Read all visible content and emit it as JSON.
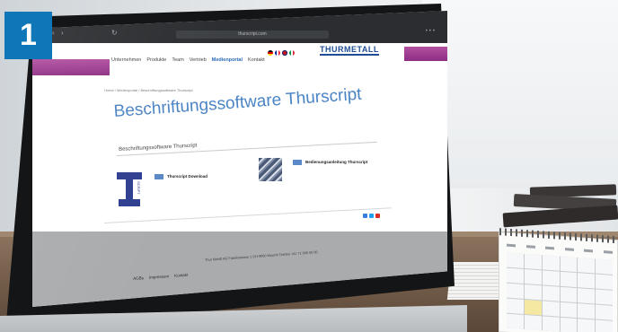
{
  "step_badge": "1",
  "browser": {
    "url": "thurscript.com"
  },
  "site": {
    "logo_text": "THURMETALL",
    "nav": [
      {
        "label": "Unternehmen",
        "active": false
      },
      {
        "label": "Produkte",
        "active": false
      },
      {
        "label": "Team",
        "active": false
      },
      {
        "label": "Vertrieb",
        "active": false
      },
      {
        "label": "Medienportal",
        "active": true
      },
      {
        "label": "Kontakt",
        "active": false
      }
    ],
    "breadcrumb": "Home  /  Medienportal  /  Beschriftungssoftware Thurscript",
    "page_title": "Beschriftungssoftware Thurscript",
    "section_heading": "Beschriftungssoftware Thurscript",
    "cards": [
      {
        "label": "Thurscript Download",
        "logo_caption": "SCRIPT"
      },
      {
        "label": "Bedienungsanleitung Thurscript"
      }
    ],
    "footer": {
      "address": "Thur Metall AG   Fabrikstrasse 1   CH-9000 Wuerth   Telefon +41 71 000 00 00",
      "links": [
        "AGBs",
        "Impressum",
        "Kontakt"
      ]
    }
  },
  "colors": {
    "badge": "#0f77b8",
    "accent_purple": "#9b3a90",
    "title_blue": "#4b84c4",
    "footer_gray": "#a9abad"
  },
  "icons": [
    "flag-de-icon",
    "flag-fr-icon",
    "flag-uk-icon",
    "flag-it-icon",
    "social-icons"
  ]
}
